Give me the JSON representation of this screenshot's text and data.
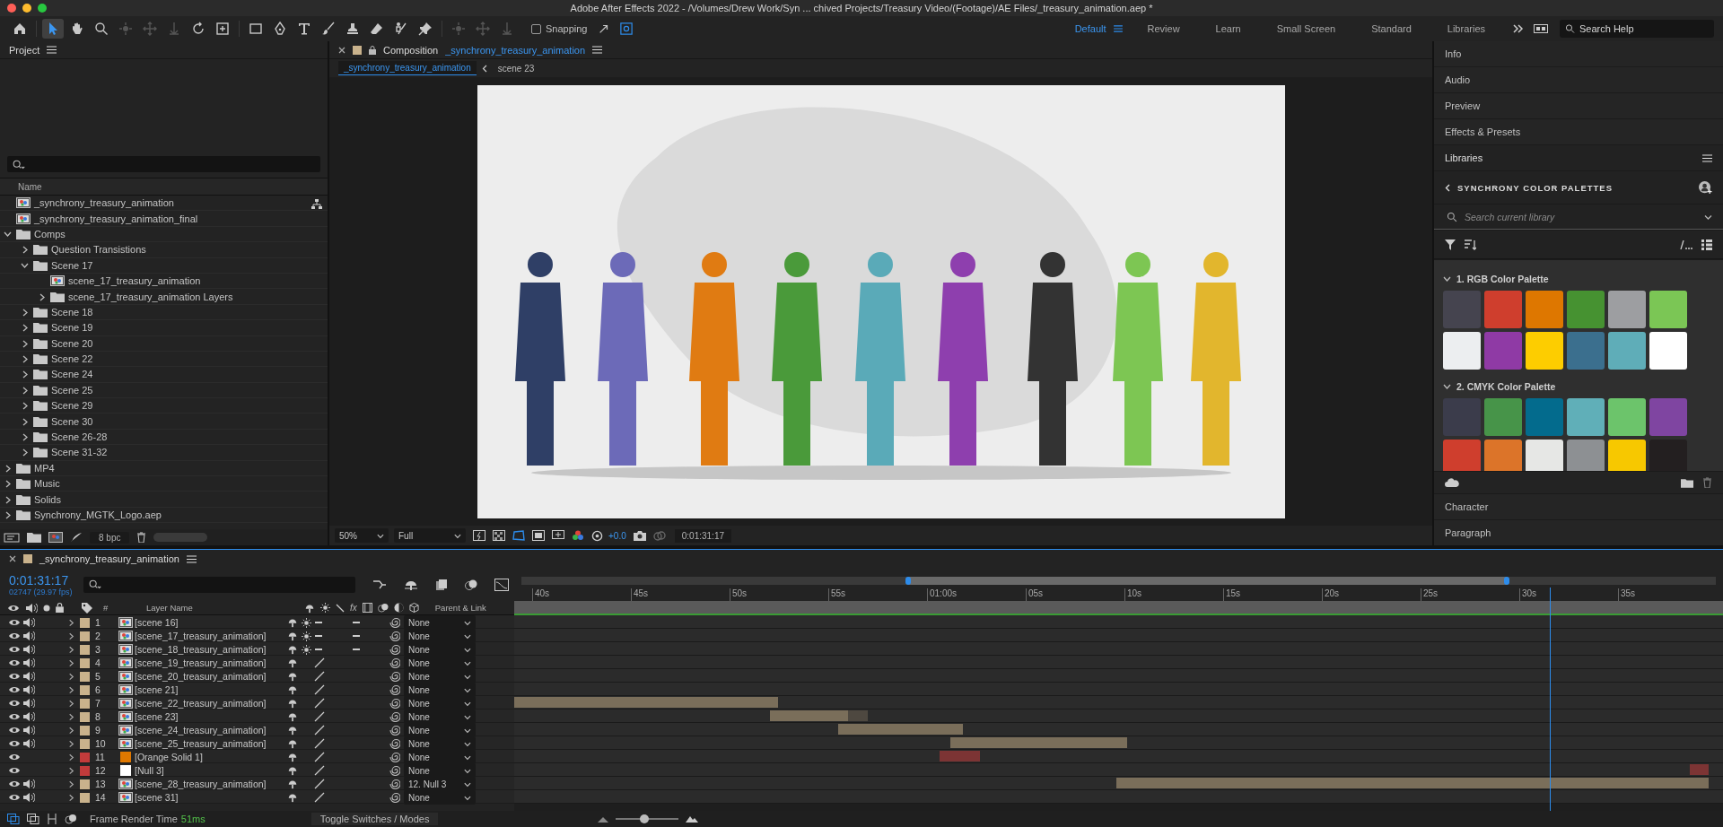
{
  "window": {
    "title": "Adobe After Effects 2022 - /Volumes/Drew Work/Syn ... chived Projects/Treasury Video/(Footage)/AE Files/_treasury_animation.aep *"
  },
  "toolbar": {
    "tools": [
      {
        "kind": "home",
        "selected": false,
        "disabled": false
      },
      {
        "kind": "pointer",
        "selected": true,
        "disabled": false
      },
      {
        "kind": "hand",
        "selected": false,
        "disabled": false
      },
      {
        "kind": "zoom",
        "selected": false,
        "disabled": false
      },
      {
        "kind": "orbit",
        "selected": false,
        "disabled": true
      },
      {
        "kind": "pan",
        "selected": false,
        "disabled": true
      },
      {
        "kind": "dolly",
        "selected": false,
        "disabled": true
      },
      {
        "kind": "rotate",
        "selected": false,
        "disabled": false
      },
      {
        "kind": "anchor",
        "selected": false,
        "disabled": false
      },
      {
        "kind": "rectangle",
        "selected": false,
        "disabled": false
      },
      {
        "kind": "pen",
        "selected": false,
        "disabled": false
      },
      {
        "kind": "type",
        "selected": false,
        "disabled": false
      },
      {
        "kind": "brush",
        "selected": false,
        "disabled": false
      },
      {
        "kind": "stamp",
        "selected": false,
        "disabled": false
      },
      {
        "kind": "eraser",
        "selected": false,
        "disabled": false
      },
      {
        "kind": "roto",
        "selected": false,
        "disabled": false
      },
      {
        "kind": "pin",
        "selected": false,
        "disabled": false
      },
      {
        "kind": "orbit",
        "selected": false,
        "disabled": true
      },
      {
        "kind": "pan",
        "selected": false,
        "disabled": true
      },
      {
        "kind": "dolly",
        "selected": false,
        "disabled": true
      }
    ],
    "snapping": {
      "label": "Snapping",
      "checked": false
    },
    "workspaces": [
      {
        "label": "Default",
        "selected": true
      },
      {
        "label": "Review",
        "selected": false
      },
      {
        "label": "Learn",
        "selected": false
      },
      {
        "label": "Small Screen",
        "selected": false
      },
      {
        "label": "Standard",
        "selected": false
      },
      {
        "label": "Libraries",
        "selected": false
      }
    ],
    "search": {
      "placeholder": "Search Help"
    }
  },
  "project": {
    "title": "Project",
    "column": "Name",
    "items": [
      {
        "kind": "comp",
        "label": "_synchrony_treasury_animation"
      },
      {
        "kind": "comp",
        "label": "_synchrony_treasury_animation_final"
      },
      {
        "kind": "folder",
        "label": "Comps",
        "expanded": true,
        "children": [
          {
            "kind": "folder",
            "label": "Question Transistions",
            "expanded": false
          },
          {
            "kind": "folder",
            "label": "Scene 17",
            "expanded": true,
            "children": [
              {
                "kind": "comp",
                "label": "scene_17_treasury_animation"
              },
              {
                "kind": "folder",
                "label": "scene_17_treasury_animation Layers",
                "expanded": false
              }
            ]
          },
          {
            "kind": "folder",
            "label": "Scene 18",
            "expanded": false
          },
          {
            "kind": "folder",
            "label": "Scene 19",
            "expanded": false
          },
          {
            "kind": "folder",
            "label": "Scene 20",
            "expanded": false
          },
          {
            "kind": "folder",
            "label": "Scene 22",
            "expanded": false
          },
          {
            "kind": "folder",
            "label": "Scene 24",
            "expanded": false
          },
          {
            "kind": "folder",
            "label": "Scene 25",
            "expanded": false
          },
          {
            "kind": "folder",
            "label": "Scene 29",
            "expanded": false
          },
          {
            "kind": "folder",
            "label": "Scene 30",
            "expanded": false
          },
          {
            "kind": "folder",
            "label": "Scene 26-28",
            "expanded": false
          },
          {
            "kind": "folder",
            "label": "Scene 31-32",
            "expanded": false
          }
        ]
      },
      {
        "kind": "folder",
        "label": "MP4",
        "expanded": false
      },
      {
        "kind": "folder",
        "label": "Music",
        "expanded": false
      },
      {
        "kind": "folder",
        "label": "Solids",
        "expanded": false
      },
      {
        "kind": "folder",
        "label": "Synchrony_MGTK_Logo.aep",
        "expanded": false
      }
    ],
    "bit_depth": "8 bpc"
  },
  "composition": {
    "label": "Composition",
    "name": "_synchrony_treasury_animation",
    "breadcrumbs": [
      {
        "label": "_synchrony_treasury_animation",
        "selected": true
      },
      {
        "label": "scene 23",
        "selected": false
      }
    ],
    "zoom": "50%",
    "resolution": "Full",
    "exposure": "+0.0",
    "timecode": "0:01:31:17"
  },
  "right_panel": {
    "panels_top": [
      "Info",
      "Audio",
      "Preview",
      "Effects & Presets"
    ],
    "libraries": {
      "title": "Libraries",
      "library": "SYNCHRONY COLOR PALETTES",
      "search": {
        "placeholder": "Search current library"
      },
      "palettes": [
        {
          "name": "1. RGB Color Palette",
          "expanded": true,
          "swatches": [
            {
              "color": "#45444f"
            },
            {
              "color": "#cf3e2d"
            },
            {
              "color": "#de7700"
            },
            {
              "color": "#469231"
            },
            {
              "color": "#9d9ea1"
            },
            {
              "color": "#7bc655"
            },
            {
              "color": "#eceef0"
            },
            {
              "color": "#8f3aa5"
            },
            {
              "color": "#fdcd00"
            },
            {
              "color": "#3b6f8e"
            },
            {
              "color": "#5fadb8"
            },
            {
              "color": "#ffffff"
            }
          ]
        },
        {
          "name": "2. CMYK Color Palette",
          "expanded": true,
          "swatches": [
            {
              "color": "#3b3c4b"
            },
            {
              "color": "#479449"
            },
            {
              "color": "#036b8d"
            },
            {
              "color": "#60afb8"
            },
            {
              "color": "#6cc46b"
            },
            {
              "color": "#7f45a1"
            },
            {
              "color": "#cf3e2d"
            },
            {
              "color": "#dc7429"
            },
            {
              "color": "#e6e7e5"
            },
            {
              "color": "#8d9093"
            },
            {
              "color": "#f7c800"
            },
            {
              "color": "#231f20"
            }
          ]
        }
      ]
    },
    "panels_bottom": [
      "Character",
      "Paragraph"
    ]
  },
  "timeline": {
    "name": "_synchrony_treasury_animation",
    "timecode": "0:01:31:17",
    "frame_info": "02747 (29.97 fps)",
    "columns": {
      "number": "#",
      "layer_name": "Layer Name",
      "effects": "fx",
      "parent": "Parent & Link"
    },
    "ruler": [
      "40s",
      "45s",
      "50s",
      "55s",
      "01:00s",
      "05s",
      "10s",
      "15s",
      "20s",
      "25s",
      "30s",
      "35s"
    ],
    "layers": [
      {
        "number": "1",
        "name": "[scene 16]",
        "kind": "comp",
        "color": "#c9b28c",
        "visible": true,
        "audio": true,
        "collapse": true,
        "parent": "None"
      },
      {
        "number": "2",
        "name": "[scene_17_treasury_animation]",
        "kind": "comp",
        "color": "#c9b28c",
        "visible": true,
        "audio": true,
        "collapse": true,
        "parent": "None"
      },
      {
        "number": "3",
        "name": "[scene_18_treasury_animation]",
        "kind": "comp",
        "color": "#c9b28c",
        "visible": true,
        "audio": true,
        "collapse": true,
        "parent": "None"
      },
      {
        "number": "4",
        "name": "[scene_19_treasury_animation]",
        "kind": "comp",
        "color": "#c9b28c",
        "visible": true,
        "audio": true,
        "collapse": false,
        "parent": "None"
      },
      {
        "number": "5",
        "name": "[scene_20_treasury_animation]",
        "kind": "comp",
        "color": "#c9b28c",
        "visible": true,
        "audio": true,
        "collapse": false,
        "parent": "None"
      },
      {
        "number": "6",
        "name": "[scene 21]",
        "kind": "comp",
        "color": "#c9b28c",
        "visible": true,
        "audio": true,
        "collapse": false,
        "parent": "None"
      },
      {
        "number": "7",
        "name": "[scene_22_treasury_animation]",
        "kind": "comp",
        "color": "#c9b28c",
        "visible": true,
        "audio": true,
        "collapse": false,
        "parent": "None"
      },
      {
        "number": "8",
        "name": "[scene 23]",
        "kind": "comp",
        "color": "#c9b28c",
        "visible": true,
        "audio": true,
        "collapse": false,
        "parent": "None"
      },
      {
        "number": "9",
        "name": "[scene_24_treasury_animation]",
        "kind": "comp",
        "color": "#c9b28c",
        "visible": true,
        "audio": true,
        "collapse": false,
        "parent": "None"
      },
      {
        "number": "10",
        "name": "[scene_25_treasury_animation]",
        "kind": "comp",
        "color": "#c9b28c",
        "visible": true,
        "audio": true,
        "collapse": false,
        "parent": "None"
      },
      {
        "number": "11",
        "name": "[Orange Solid 1]",
        "kind": "solid",
        "source": {
          "color": "#e07800"
        },
        "color": "#c23b3b",
        "visible": true,
        "audio": false,
        "collapse": false,
        "parent": "None"
      },
      {
        "number": "12",
        "name": "[Null 3]",
        "kind": "null",
        "source": {
          "color": "#ffffff"
        },
        "color": "#c23b3b",
        "visible": true,
        "audio": false,
        "collapse": false,
        "parent": "None"
      },
      {
        "number": "13",
        "name": "[scene_28_treasury_animation]",
        "kind": "comp",
        "color": "#c9b28c",
        "visible": true,
        "audio": true,
        "collapse": false,
        "parent": "12. Null 3"
      },
      {
        "number": "14",
        "name": "[scene 31]",
        "kind": "comp",
        "color": "#c9b28c",
        "visible": true,
        "audio": true,
        "collapse": false,
        "parent": "None"
      }
    ],
    "render_label": "Frame Render Time",
    "render_time": "51ms",
    "toggle": "Toggle Switches / Modes",
    "zoom_slider": {
      "level": 0.45
    }
  }
}
